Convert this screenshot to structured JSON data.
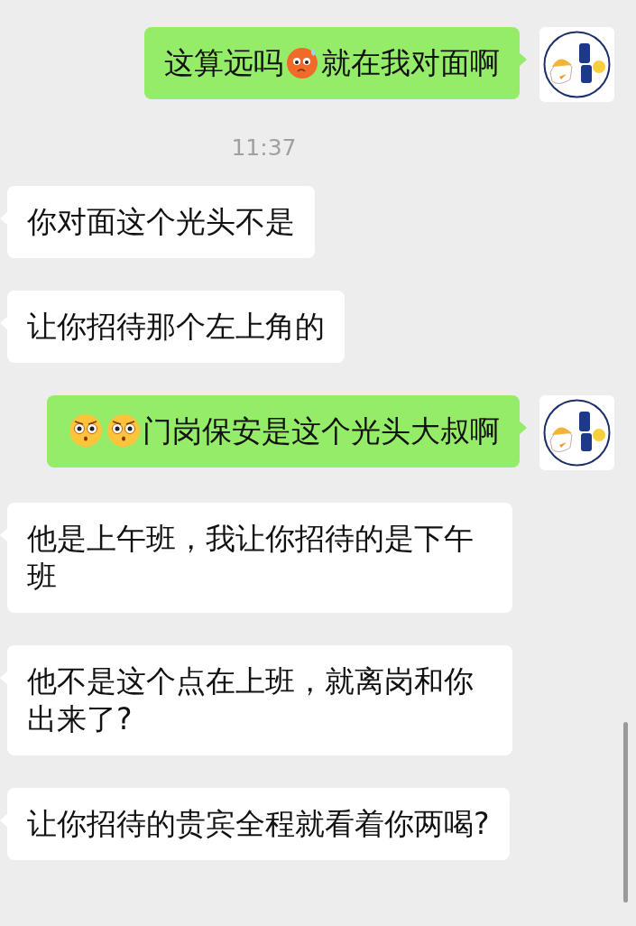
{
  "messages": [
    {
      "kind": "outgoing",
      "parts": [
        {
          "kind": "text",
          "text": "这算远吗"
        },
        {
          "kind": "sweat"
        },
        {
          "kind": "text",
          "text": "就在我对面啊"
        }
      ]
    },
    {
      "kind": "time",
      "text": "11:37"
    },
    {
      "kind": "incoming",
      "parts": [
        {
          "kind": "text",
          "text": "你对面这个光头不是"
        }
      ]
    },
    {
      "kind": "incoming",
      "parts": [
        {
          "kind": "text",
          "text": "让你招待那个左上角的"
        }
      ]
    },
    {
      "kind": "outgoing",
      "parts": [
        {
          "kind": "shock"
        },
        {
          "kind": "shock"
        },
        {
          "kind": "text",
          "text": "门岗保安是这个光头大叔啊"
        }
      ]
    },
    {
      "kind": "incoming",
      "parts": [
        {
          "kind": "text",
          "text": "他是上午班，我让你招待的是下午班"
        }
      ]
    },
    {
      "kind": "incoming",
      "parts": [
        {
          "kind": "text",
          "text": "他不是这个点在上班，就离岗和你出来了?"
        }
      ]
    },
    {
      "kind": "incoming",
      "parts": [
        {
          "kind": "text",
          "text": "让你招待的贵宾全程就看着你两喝?"
        }
      ]
    }
  ]
}
